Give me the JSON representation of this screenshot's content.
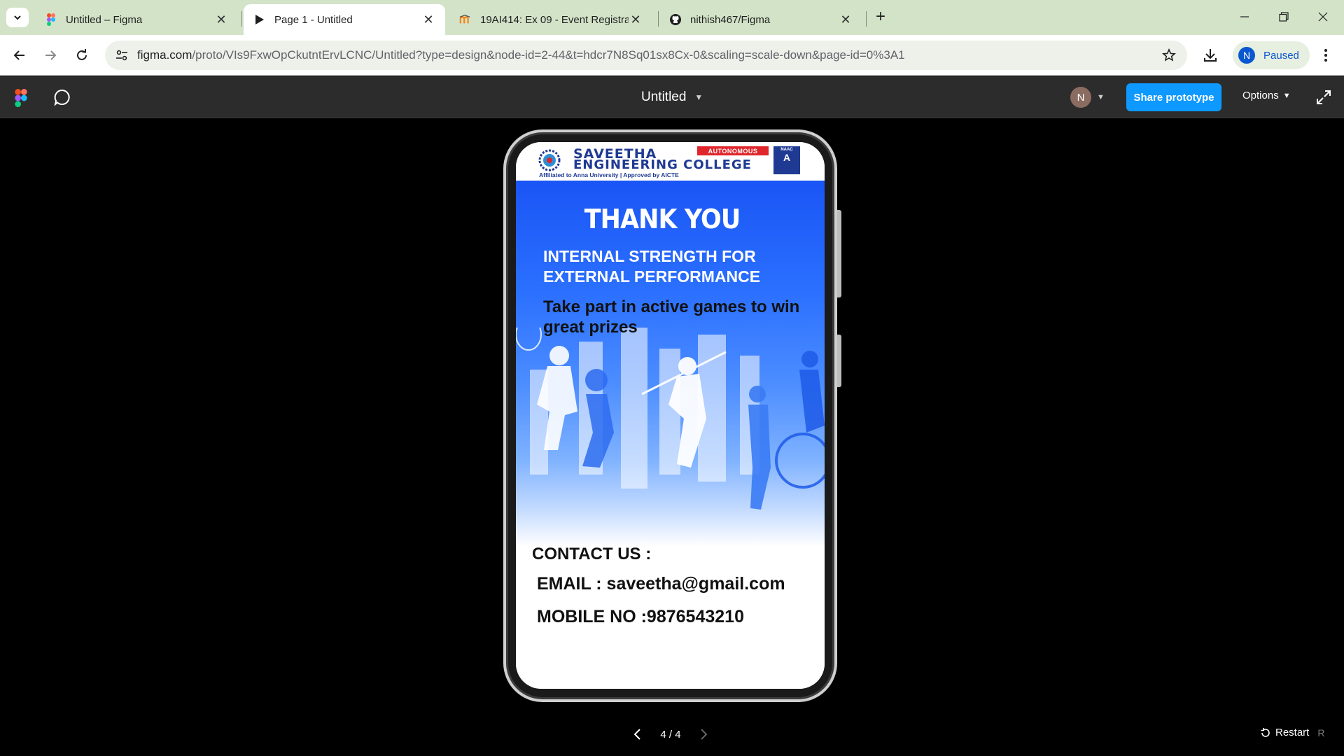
{
  "browser": {
    "tabs": [
      {
        "title": "Untitled – Figma",
        "icon": "figma-icon",
        "active": false
      },
      {
        "title": "Page 1 - Untitled",
        "icon": "play-icon",
        "active": true
      },
      {
        "title": "19AI414: Ex 09 - Event Registrat",
        "icon": "moodle-icon",
        "active": false
      },
      {
        "title": "nithish467/Figma",
        "icon": "github-icon",
        "active": false
      }
    ],
    "url_main": "figma.com",
    "url_rest": "/proto/VIs9FxwOpCkutntErvLCNC/Untitled?type=design&node-id=2-44&t=hdcr7N8Sq01sx8Cx-0&scaling=scale-down&page-id=0%3A1",
    "profile_initial": "N",
    "profile_status": "Paused"
  },
  "figma": {
    "file_title": "Untitled",
    "user_initial": "N",
    "share_label": "Share prototype",
    "options_label": "Options",
    "pager_label": "4 / 4",
    "restart_label": "Restart",
    "restart_key": "R"
  },
  "poster": {
    "college_name_line1": "SAVEETHA",
    "college_name_line2": "ENGINEERING COLLEGE",
    "college_affiliation": "Affiliated to Anna University | Approved by AICTE",
    "autonomous_badge": "AUTONOMOUS",
    "naac_label": "NAAC",
    "naac_grade": "A",
    "heading": "THANK YOU",
    "tagline": "INTERNAL STRENGTH FOR EXTERNAL PERFORMANCE",
    "body": "Take part in active games to win great prizes",
    "contact_heading": "CONTACT US :",
    "email_line": "EMAIL : saveetha@gmail.com",
    "mobile_line": "MOBILE NO :9876543210"
  },
  "colors": {
    "figma_blue": "#0d99ff",
    "poster_blue": "#1a55f5",
    "chrome_green": "#d3e3c8"
  }
}
